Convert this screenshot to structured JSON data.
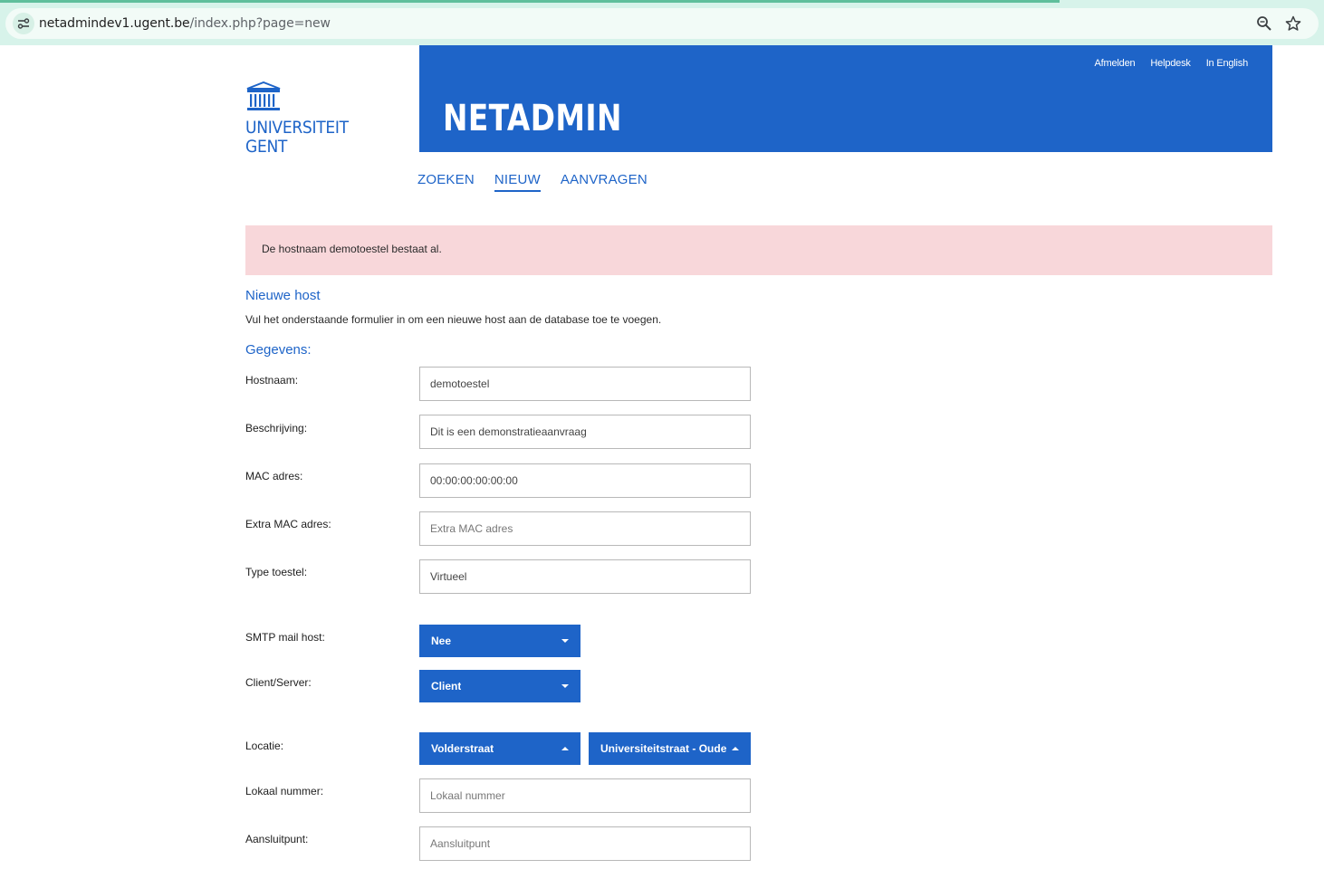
{
  "browser": {
    "url_host": "netadmindev1.ugent.be",
    "url_path": "/index.php?page=new",
    "icons": [
      "site-info-icon",
      "zoom-icon",
      "bookmark-star-icon"
    ]
  },
  "header": {
    "logo_line1": "UNIVERSITEIT",
    "logo_line2": "GENT",
    "app_title": "NETADMIN",
    "links": {
      "logout": "Afmelden",
      "helpdesk": "Helpdesk",
      "english": "In English"
    }
  },
  "nav": {
    "search": "ZOEKEN",
    "new": "NIEUW",
    "requests": "AANVRAGEN",
    "active": "NIEUW"
  },
  "alert": {
    "message": "De hostnaam demotoestel bestaat al."
  },
  "form": {
    "title": "Nieuwe host",
    "intro": "Vul het onderstaande formulier in om een nieuwe host aan de database toe te voegen.",
    "section": "Gegevens:",
    "hostname": {
      "label": "Hostnaam:",
      "value": "demotoestel",
      "placeholder": ""
    },
    "description": {
      "label": "Beschrijving:",
      "value": "Dit is een demonstratieaanvraag",
      "placeholder": ""
    },
    "mac": {
      "label": "MAC adres:",
      "value": "00:00:00:00:00:00",
      "placeholder": ""
    },
    "extra_mac": {
      "label": "Extra MAC adres:",
      "value": "",
      "placeholder": "Extra MAC adres"
    },
    "device_type": {
      "label": "Type toestel:",
      "value": "Virtueel",
      "placeholder": ""
    },
    "smtp": {
      "label": "SMTP mail host:",
      "selected": "Nee"
    },
    "client_server": {
      "label": "Client/Server:",
      "selected": "Client"
    },
    "location": {
      "label": "Locatie:",
      "street_selected": "Volderstraat",
      "building_selected": "Universiteitstraat - Oude S"
    },
    "room": {
      "label": "Lokaal nummer:",
      "value": "",
      "placeholder": "Lokaal nummer"
    },
    "outlet": {
      "label": "Aansluitpunt:",
      "value": "",
      "placeholder": "Aansluitpunt"
    }
  },
  "colors": {
    "brand": "#1e64c8",
    "alert_bg": "#f8d7da",
    "chrome_bg": "#d7f3ea"
  }
}
